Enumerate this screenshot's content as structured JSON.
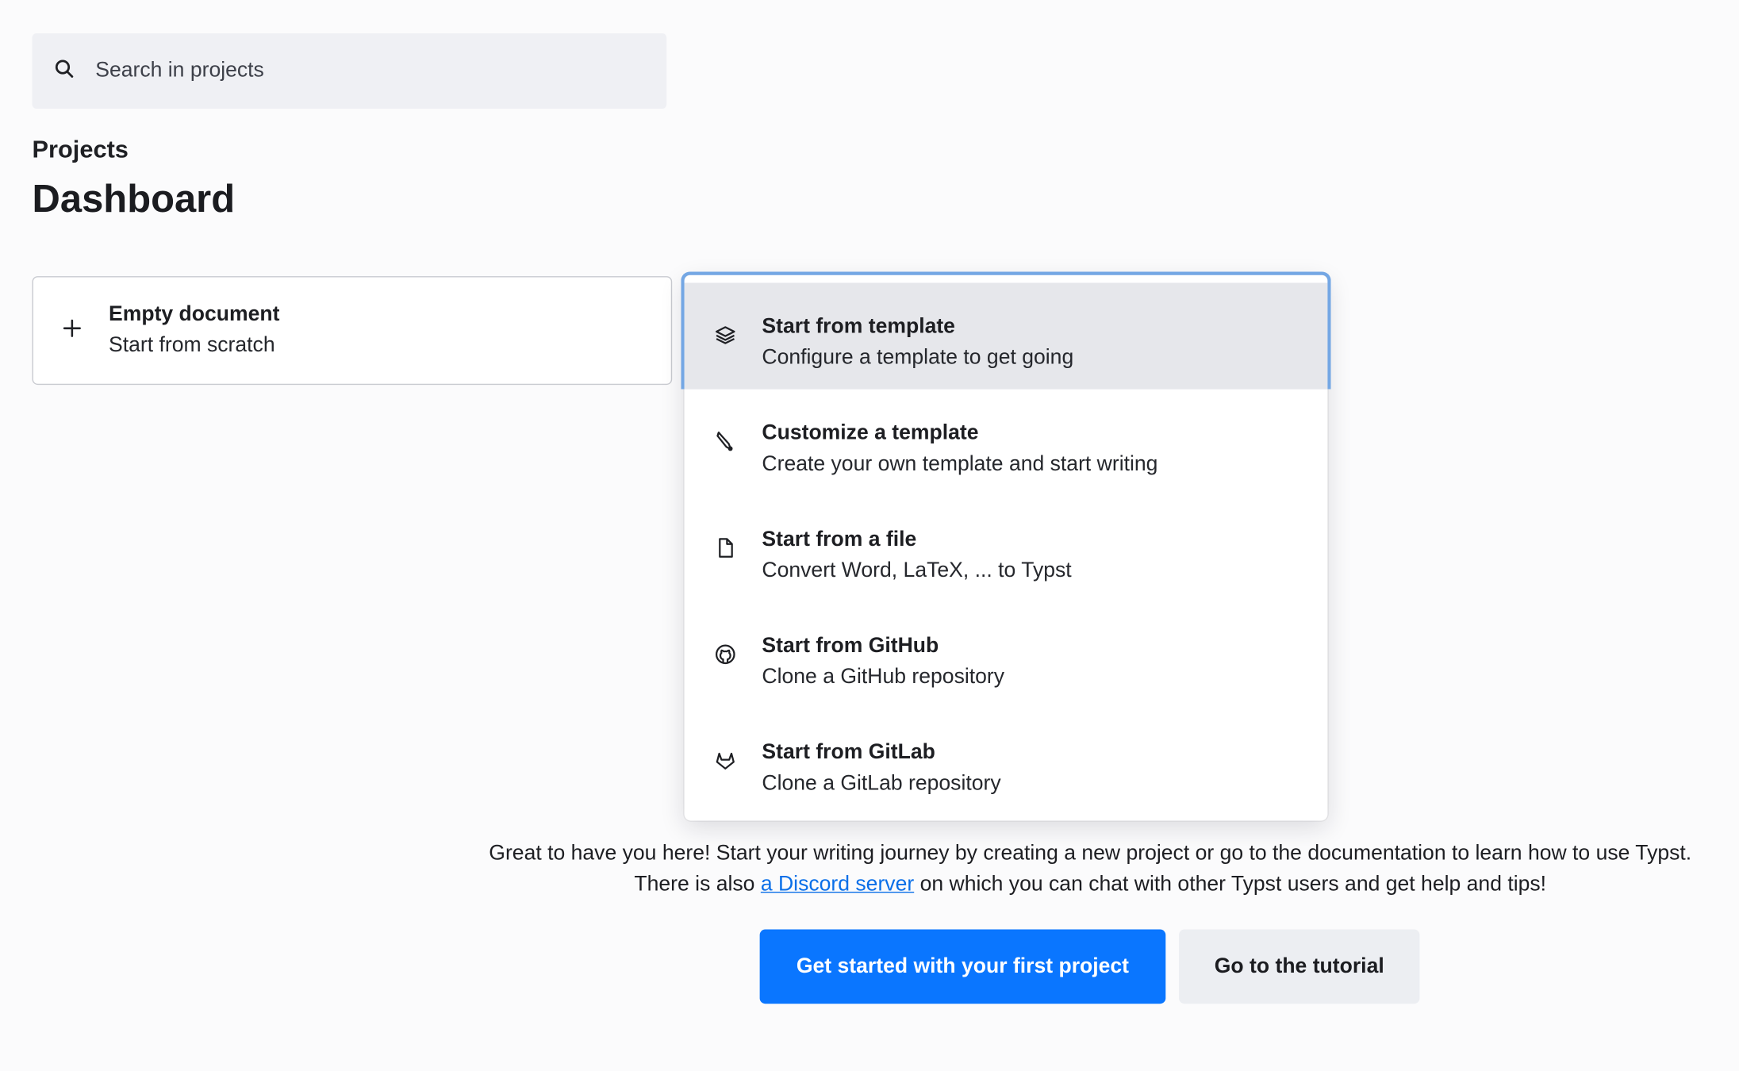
{
  "search": {
    "placeholder": "Search in projects",
    "icon": "search-icon"
  },
  "header": {
    "breadcrumb": "Projects",
    "title": "Dashboard"
  },
  "new_project": {
    "empty": {
      "icon": "plus-icon",
      "title": "Empty document",
      "subtitle": "Start from scratch"
    }
  },
  "menu": {
    "items": [
      {
        "icon": "layers-icon",
        "title": "Start from template",
        "subtitle": "Configure a template to get going",
        "active": true
      },
      {
        "icon": "pen-nib-icon",
        "title": "Customize a template",
        "subtitle": "Create your own template and start writing",
        "active": false
      },
      {
        "icon": "file-icon",
        "title": "Start from a file",
        "subtitle": "Convert Word, LaTeX, ... to Typst",
        "active": false
      },
      {
        "icon": "github-icon",
        "title": "Start from GitHub",
        "subtitle": "Clone a GitHub repository",
        "active": false
      },
      {
        "icon": "gitlab-icon",
        "title": "Start from GitLab",
        "subtitle": "Clone a GitLab repository",
        "active": false
      }
    ]
  },
  "welcome": {
    "line1": "Great to have you here! Start your writing journey by creating a new project or go to the documentation to learn how to use Typst.",
    "line2_before": "There is also ",
    "line2_link": "a Discord server",
    "line2_after": " on which you can chat with other Typst users and get help and tips!"
  },
  "actions": {
    "primary": "Get started with your first project",
    "secondary": "Go to the tutorial"
  },
  "colors": {
    "accent": "#0a76ff",
    "link": "#0a6fe8",
    "focus_ring": "#74a7e4",
    "active_item_bg": "#e6e7eb"
  }
}
